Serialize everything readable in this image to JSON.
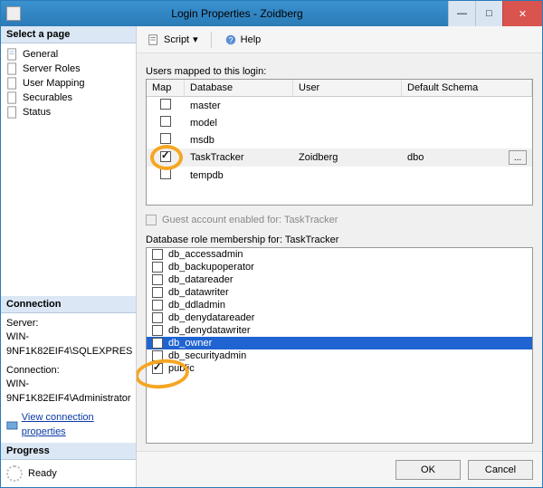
{
  "window": {
    "title": "Login Properties - Zoidberg"
  },
  "titlebar": {
    "min": "—",
    "max": "□",
    "close": "✕"
  },
  "leftnav": {
    "header": "Select a page",
    "items": [
      {
        "label": "General"
      },
      {
        "label": "Server Roles"
      },
      {
        "label": "User Mapping"
      },
      {
        "label": "Securables"
      },
      {
        "label": "Status"
      }
    ]
  },
  "connection": {
    "header": "Connection",
    "server_label": "Server:",
    "server_value": "WIN-9NF1K82EIF4\\SQLEXPRES",
    "conn_label": "Connection:",
    "conn_value": "WIN-9NF1K82EIF4\\Administrator",
    "link_label": "View connection properties"
  },
  "progress": {
    "header": "Progress",
    "status": "Ready"
  },
  "toolbar": {
    "script": "Script",
    "help": "Help"
  },
  "users_mapped": {
    "label": "Users mapped to this login:",
    "col_map": "Map",
    "col_db": "Database",
    "col_user": "User",
    "col_schema": "Default Schema",
    "rows": [
      {
        "checked": false,
        "db": "master",
        "user": "",
        "schema": ""
      },
      {
        "checked": false,
        "db": "model",
        "user": "",
        "schema": ""
      },
      {
        "checked": false,
        "db": "msdb",
        "user": "",
        "schema": ""
      },
      {
        "checked": true,
        "db": "TaskTracker",
        "user": "Zoidberg",
        "schema": "dbo",
        "selected": true
      },
      {
        "checked": false,
        "db": "tempdb",
        "user": "",
        "schema": ""
      }
    ]
  },
  "guest": {
    "label": "Guest account enabled for: TaskTracker"
  },
  "roles": {
    "label": "Database role membership for: TaskTracker",
    "items": [
      {
        "checked": false,
        "name": "db_accessadmin"
      },
      {
        "checked": false,
        "name": "db_backupoperator"
      },
      {
        "checked": false,
        "name": "db_datareader"
      },
      {
        "checked": false,
        "name": "db_datawriter"
      },
      {
        "checked": false,
        "name": "db_ddladmin"
      },
      {
        "checked": false,
        "name": "db_denydatareader"
      },
      {
        "checked": false,
        "name": "db_denydatawriter"
      },
      {
        "checked": true,
        "name": "db_owner",
        "selected": true
      },
      {
        "checked": false,
        "name": "db_securityadmin"
      },
      {
        "checked": true,
        "name": "public"
      }
    ]
  },
  "buttons": {
    "ok": "OK",
    "cancel": "Cancel"
  },
  "ellipsis": "..."
}
